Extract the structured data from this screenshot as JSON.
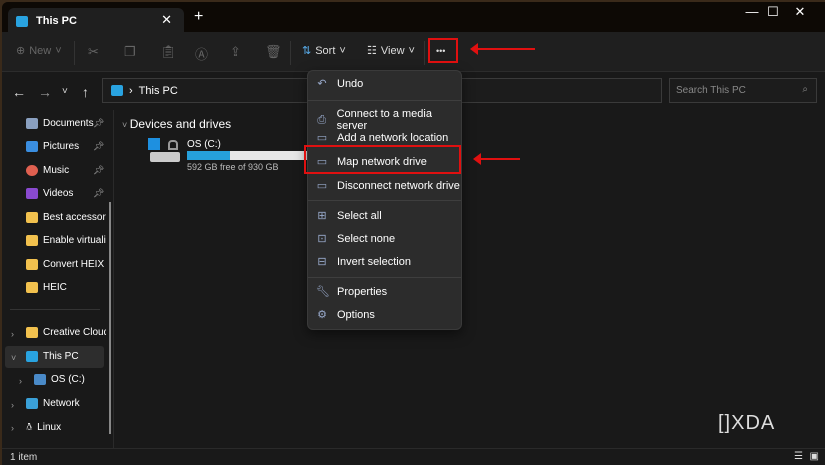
{
  "tab": {
    "title": "This PC",
    "close": "✕",
    "new_tab": "+"
  },
  "window_controls": {
    "minimize": "—",
    "maximize": "☐",
    "close": "✕"
  },
  "toolbar": {
    "new": "New",
    "sort": "Sort",
    "view": "View",
    "more": "•••"
  },
  "address": {
    "path": "This PC",
    "search_placeholder": "Search This PC"
  },
  "nav_pane": {
    "quick": [
      {
        "label": "Documents",
        "pinned": true,
        "color": "#8aa0c0"
      },
      {
        "label": "Pictures",
        "pinned": true,
        "color": "#3a8ee0"
      },
      {
        "label": "Music",
        "pinned": true,
        "color": "#e06050"
      },
      {
        "label": "Videos",
        "pinned": true,
        "color": "#8a4ad0"
      },
      {
        "label": "Best accessories",
        "color": "#f2c14e"
      },
      {
        "label": "Enable virtualiza",
        "color": "#f2c14e"
      },
      {
        "label": "Convert HEIX im",
        "color": "#f2c14e"
      },
      {
        "label": "HEIC",
        "color": "#f2c14e"
      }
    ],
    "tree": [
      {
        "label": "Creative Cloud F"
      },
      {
        "label": "This PC"
      },
      {
        "label": "OS (C:)"
      },
      {
        "label": "Network"
      },
      {
        "label": "Linux"
      }
    ]
  },
  "content": {
    "section": "Devices and drives",
    "drive": {
      "name": "OS (C:)",
      "free_text": "592 GB free of 930 GB",
      "used_fraction": 0.36
    }
  },
  "menu": {
    "items": [
      "Undo",
      "Connect to a media server",
      "Add a network location",
      "Map network drive",
      "Disconnect network drive",
      "Select all",
      "Select none",
      "Invert selection",
      "Properties",
      "Options"
    ]
  },
  "status": {
    "count": "1 item"
  },
  "watermark": "XDA"
}
